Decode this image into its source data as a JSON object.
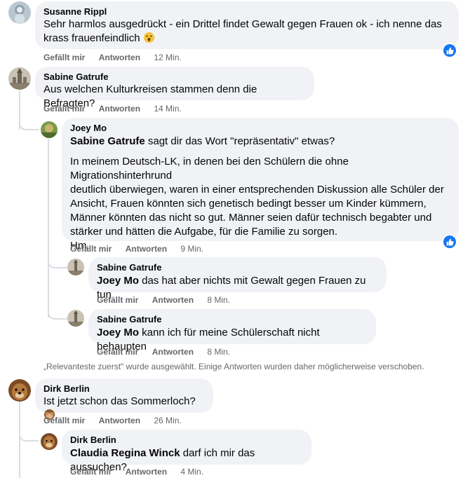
{
  "comments": {
    "susanne": {
      "author": "Susanne Rippl",
      "text_line1": "Sehr harmlos ausgedrückt - ein Drittel findet Gewalt gegen Frauen ok - ich nenne das",
      "text_line2": "krass frauenfeindlich",
      "like": "Gefällt mir",
      "reply": "Antworten",
      "time": "12 Min."
    },
    "sabine1": {
      "author": "Sabine Gatrufe",
      "text": "Aus welchen Kulturkreisen stammen denn die Befragten?",
      "like": "Gefällt mir",
      "reply": "Antworten",
      "time": "14 Min."
    },
    "joey": {
      "author": "Joey Mo",
      "mention": "Sabine Gatrufe",
      "text_first": " sagt dir das Wort \"repräsentativ\" etwas?",
      "para_lines": [
        "In meinem Deutsch-LK, in denen bei den Schülern die ohne Migrationshinterhrund",
        "deutlich überwiegen, waren in einer entsprechenden Diskussion alle Schüler der",
        "Ansicht, Frauen könnten sich genetisch bedingt besser um Kinder kümmern,",
        "Männer könnten das nicht so gut. Männer seien dafür technisch begabter und",
        "stärker und hätten die Aufgabe, für die Familie zu sorgen.",
        "Hm."
      ],
      "like": "Gefällt mir",
      "reply": "Antworten",
      "time": "9 Min."
    },
    "sabine2": {
      "author": "Sabine Gatrufe",
      "mention": "Joey Mo",
      "text": " das hat aber nichts mit Gewalt gegen Frauen zu tun",
      "like": "Gefällt mir",
      "reply": "Antworten",
      "time": "8 Min."
    },
    "sabine3": {
      "author": "Sabine Gatrufe",
      "mention": "Joey Mo",
      "text": " kann ich für meine Schülerschaft nicht behaupten",
      "like": "Gefällt mir",
      "reply": "Antworten",
      "time": "8 Min."
    },
    "dirk1": {
      "author": "Dirk Berlin",
      "text": "Ist jetzt schon das Sommerloch?",
      "like": "Gefällt mir",
      "reply": "Antworten",
      "time": "26 Min."
    },
    "dirk2": {
      "author": "Dirk Berlin",
      "mention": "Claudia Regina Winck",
      "text": " darf ich mir das aussuchen?",
      "like": "Gefällt mir",
      "reply": "Antworten",
      "time": "4 Min."
    }
  },
  "sort_note": "„Relevanteste zuerst\" wurde ausgewählt. Einige Antworten wurden daher möglicherweise verschoben.",
  "icons": {
    "like_badge": "thumbs-up-icon",
    "emoji_surprised": "surprised-face-icon",
    "emoji_monkey": "see-no-evil-monkey-icon"
  },
  "colors": {
    "bubble": "#f0f2f5",
    "like_blue": "#1877f2",
    "meta_text": "#65676b"
  }
}
